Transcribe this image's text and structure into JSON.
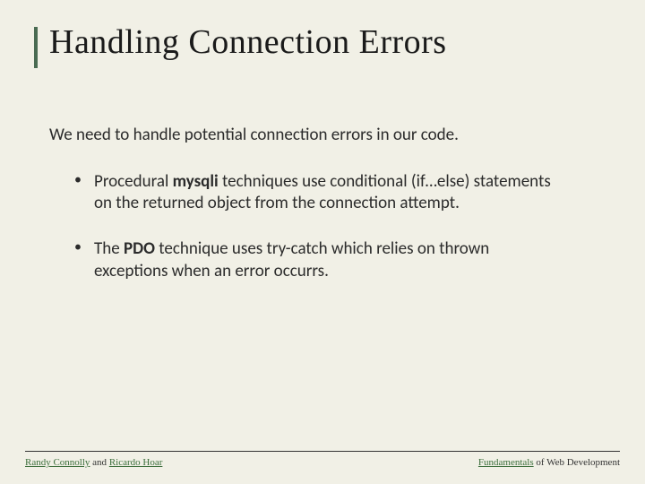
{
  "title": "Handling Connection Errors",
  "intro": "We need to handle potential connection errors in our code.",
  "bullets": [
    {
      "pre": "Procedural ",
      "strong": "mysqli",
      "post": " techniques use conditional (if…else) statements on the returned object from the connection attempt."
    },
    {
      "pre": "The ",
      "strong": "PDO",
      "post": " technique uses try-catch which relies on thrown exceptions when an error occurrs."
    }
  ],
  "footer": {
    "author1": "Randy Connolly",
    "joiner": " and ",
    "author2": "Ricardo Hoar",
    "book_strong": "Fundamentals",
    "book_rest": " of Web Development"
  }
}
